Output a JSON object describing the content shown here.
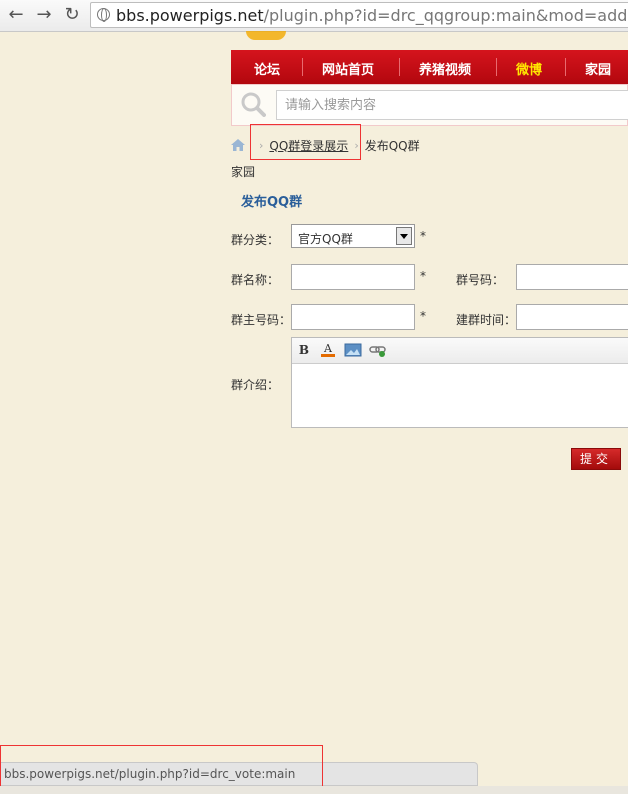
{
  "browser": {
    "url_domain": "bbs.powerpigs.net",
    "url_path": "/plugin.php?id=drc_qqgroup:main&mod=add"
  },
  "nav": {
    "items": [
      "论坛",
      "网站首页",
      "养猪视频",
      "微博",
      "家园"
    ],
    "highlight_color": "#ffe600"
  },
  "search": {
    "placeholder": "请输入搜索内容"
  },
  "breadcrumb": {
    "link": "QQ群登录展示",
    "current": "发布QQ群",
    "sub": "家园"
  },
  "form": {
    "title": "发布QQ群",
    "category_label": "群分类：",
    "category_value": "官方QQ群",
    "name_label": "群名称：",
    "number_label": "群号码：",
    "owner_label": "群主号码：",
    "created_label": "建群时间：",
    "intro_label": "群介绍：",
    "required_mark": "*",
    "submit_label": "提交"
  },
  "statusbar": {
    "text": "bbs.powerpigs.net/plugin.php?id=drc_vote:main"
  },
  "colors": {
    "nav_red": "#c80d14",
    "title_blue": "#2a5e9a",
    "highlight_box": "#ee3333"
  }
}
